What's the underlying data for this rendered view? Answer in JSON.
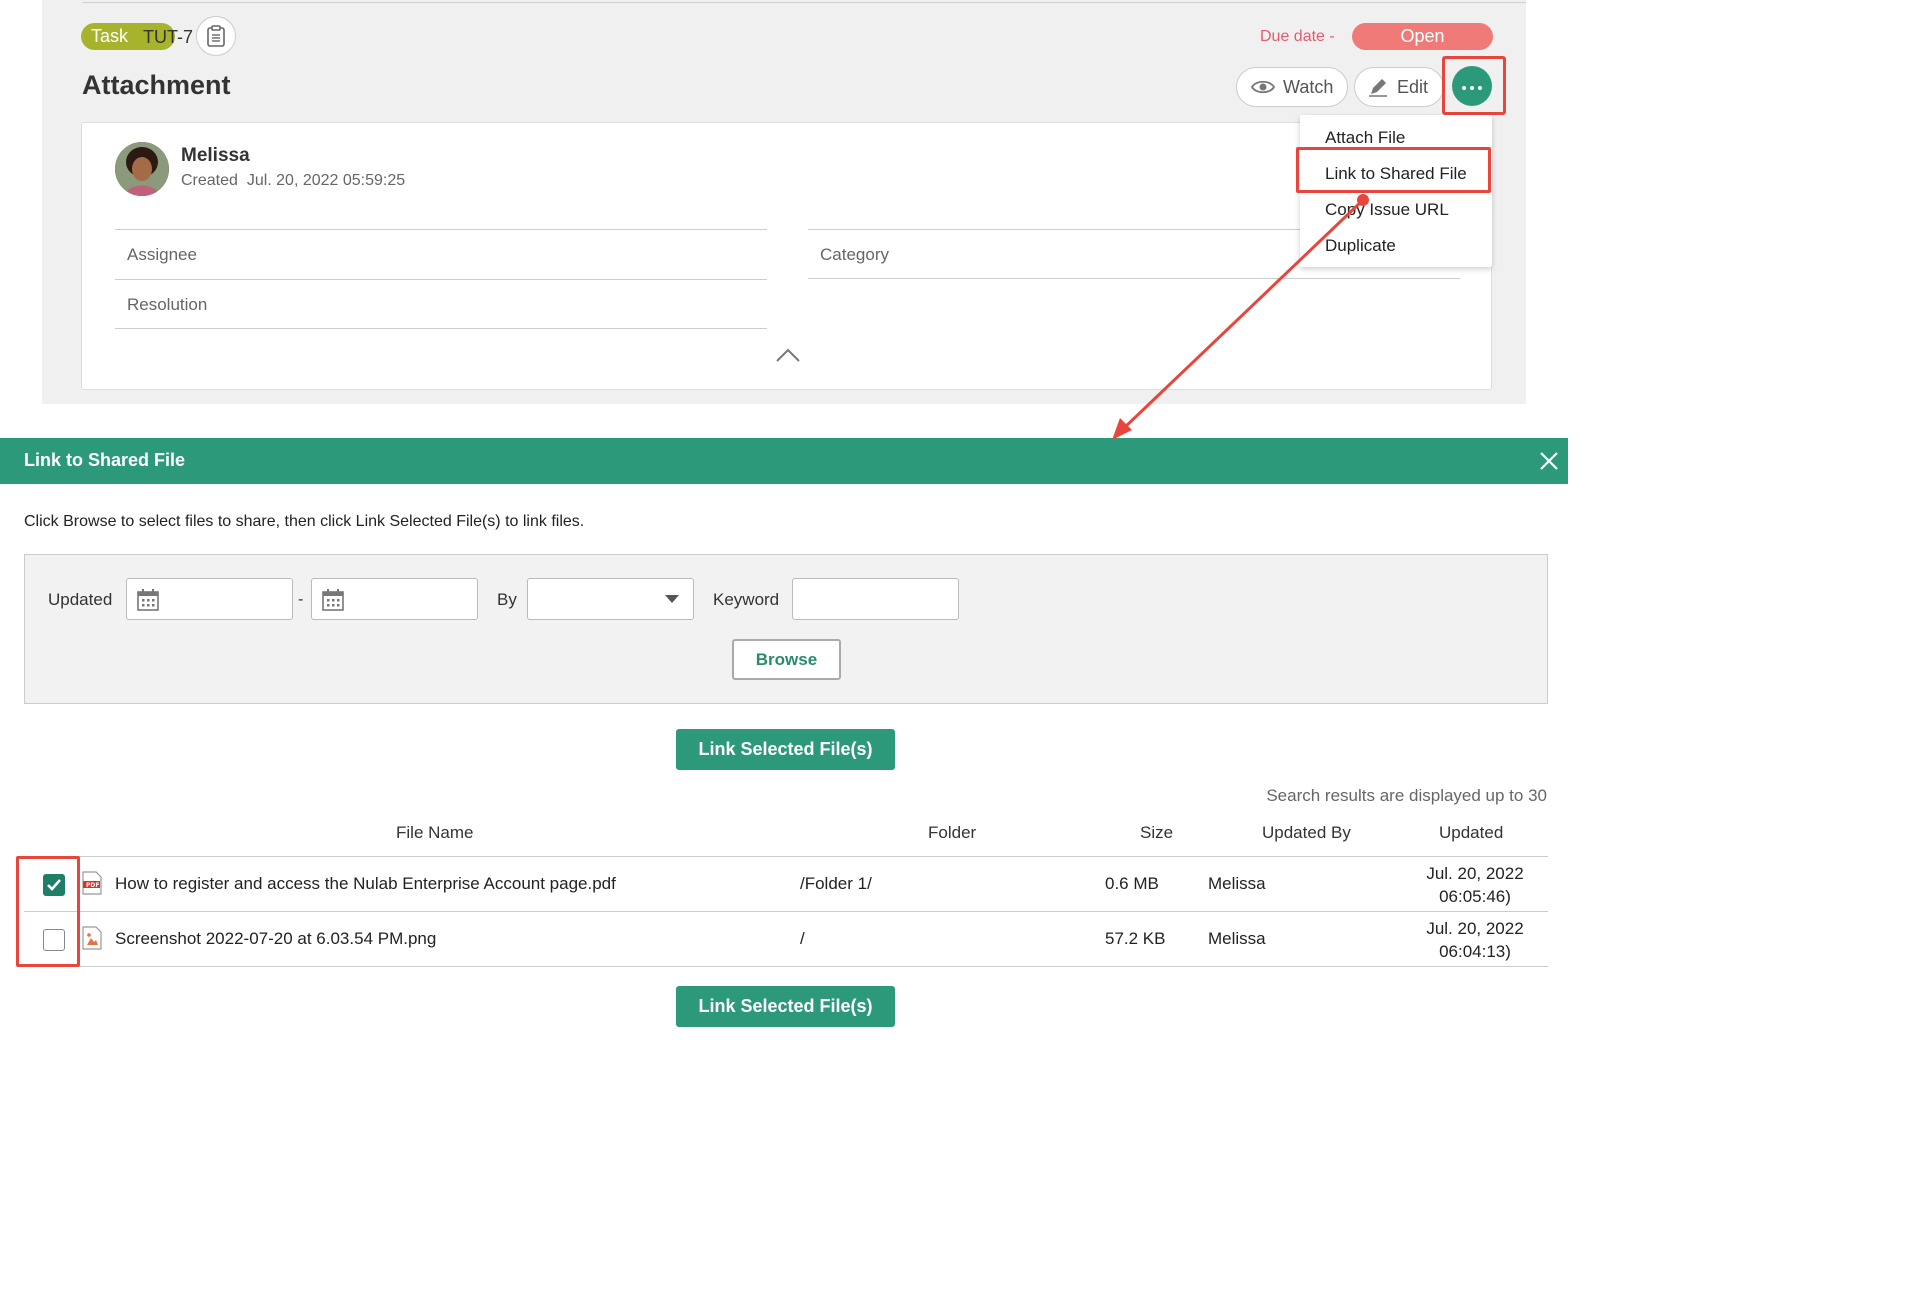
{
  "issue": {
    "type_badge": "Task",
    "key": "TUT-7",
    "due_date_label": "Due date",
    "due_date_value": "-",
    "status": "Open",
    "title": "Attachment",
    "watch_label": "Watch",
    "edit_label": "Edit",
    "author": "Melissa",
    "created_label": "Created",
    "created_value": "Jul. 20, 2022 05:59:25",
    "fields": {
      "assignee": "Assignee",
      "category": "Category",
      "resolution": "Resolution"
    },
    "menu_items": [
      "Attach File",
      "Link to Shared File",
      "Copy Issue URL",
      "Duplicate"
    ]
  },
  "dialog": {
    "title": "Link to Shared File",
    "instructions": "Click Browse to select files to share, then click Link Selected File(s) to link files.",
    "filter": {
      "updated_label": "Updated",
      "range_separator": "-",
      "by_label": "By",
      "keyword_label": "Keyword",
      "browse_label": "Browse"
    },
    "link_button_label": "Link Selected File(s)",
    "results_note": "Search results are displayed up to 30",
    "columns": [
      "File Name",
      "Folder",
      "Size",
      "Updated By",
      "Updated"
    ],
    "rows": [
      {
        "checked": true,
        "file_type": "pdf-icon",
        "name": "How to register and access the Nulab Enterprise Account page.pdf",
        "folder": "/Folder 1/",
        "size": "0.6 MB",
        "updated_by": "Melissa",
        "updated_date": "Jul. 20, 2022",
        "updated_time": "06:05:46)"
      },
      {
        "checked": false,
        "file_type": "image-icon",
        "name": "Screenshot 2022-07-20 at 6.03.54 PM.png",
        "folder": "/",
        "size": "57.2 KB",
        "updated_by": "Melissa",
        "updated_date": "Jul. 20, 2022",
        "updated_time": "06:04:13)"
      }
    ]
  },
  "colors": {
    "primary_green": "#2c9a7a",
    "status_open": "#f07a78",
    "task_badge": "#a8b32c",
    "highlight_red": "#e8453c"
  }
}
